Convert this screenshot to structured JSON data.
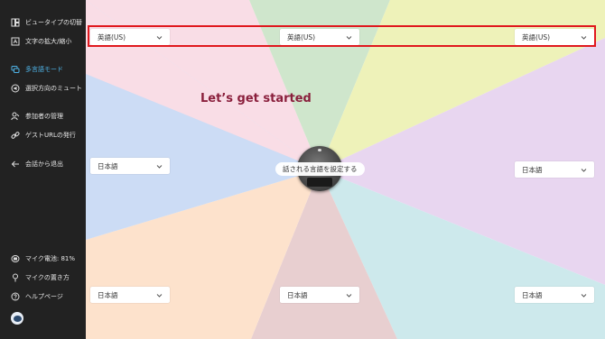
{
  "sidebar": {
    "items": [
      {
        "label": "ビュータイプの切替",
        "icon": "view-toggle-icon"
      },
      {
        "label": "文字の拡大/縮小",
        "icon": "text-size-icon"
      },
      {
        "label": "多言語モード",
        "icon": "multilingual-icon",
        "active": true
      },
      {
        "label": "選択方向のミュート",
        "icon": "mute-direction-icon"
      },
      {
        "label": "参加者の管理",
        "icon": "participants-icon"
      },
      {
        "label": "ゲストURLの発行",
        "icon": "link-icon"
      },
      {
        "label": "会話から退出",
        "icon": "exit-arrow-icon"
      }
    ],
    "bottom_items": [
      {
        "label": "マイク電池: 81%",
        "icon": "battery-icon"
      },
      {
        "label": "マイクの置き方",
        "icon": "mic-placement-icon"
      },
      {
        "label": "ヘルプページ",
        "icon": "help-icon"
      }
    ]
  },
  "main": {
    "headline": "Let’s get started",
    "center_label": "話される言語を設定する",
    "dropdowns": {
      "top_left": "英語(US)",
      "top_center": "英語(US)",
      "top_right": "英語(US)",
      "mid_left": "日本語",
      "mid_right": "日本語",
      "bottom_left": "日本語",
      "bottom_center": "日本語",
      "bottom_right": "日本語"
    }
  },
  "colors": {
    "sidebar_bg": "#222222",
    "active_item": "#4fb3e6",
    "headline": "#8a1f3c",
    "highlight_border": "#e0181e",
    "sectors": [
      "#f9dde6",
      "#cfe6cc",
      "#eef2b9",
      "#e8d6f0",
      "#cde9ec",
      "#e8cfd0",
      "#fde2cc",
      "#ccdcf5"
    ]
  }
}
